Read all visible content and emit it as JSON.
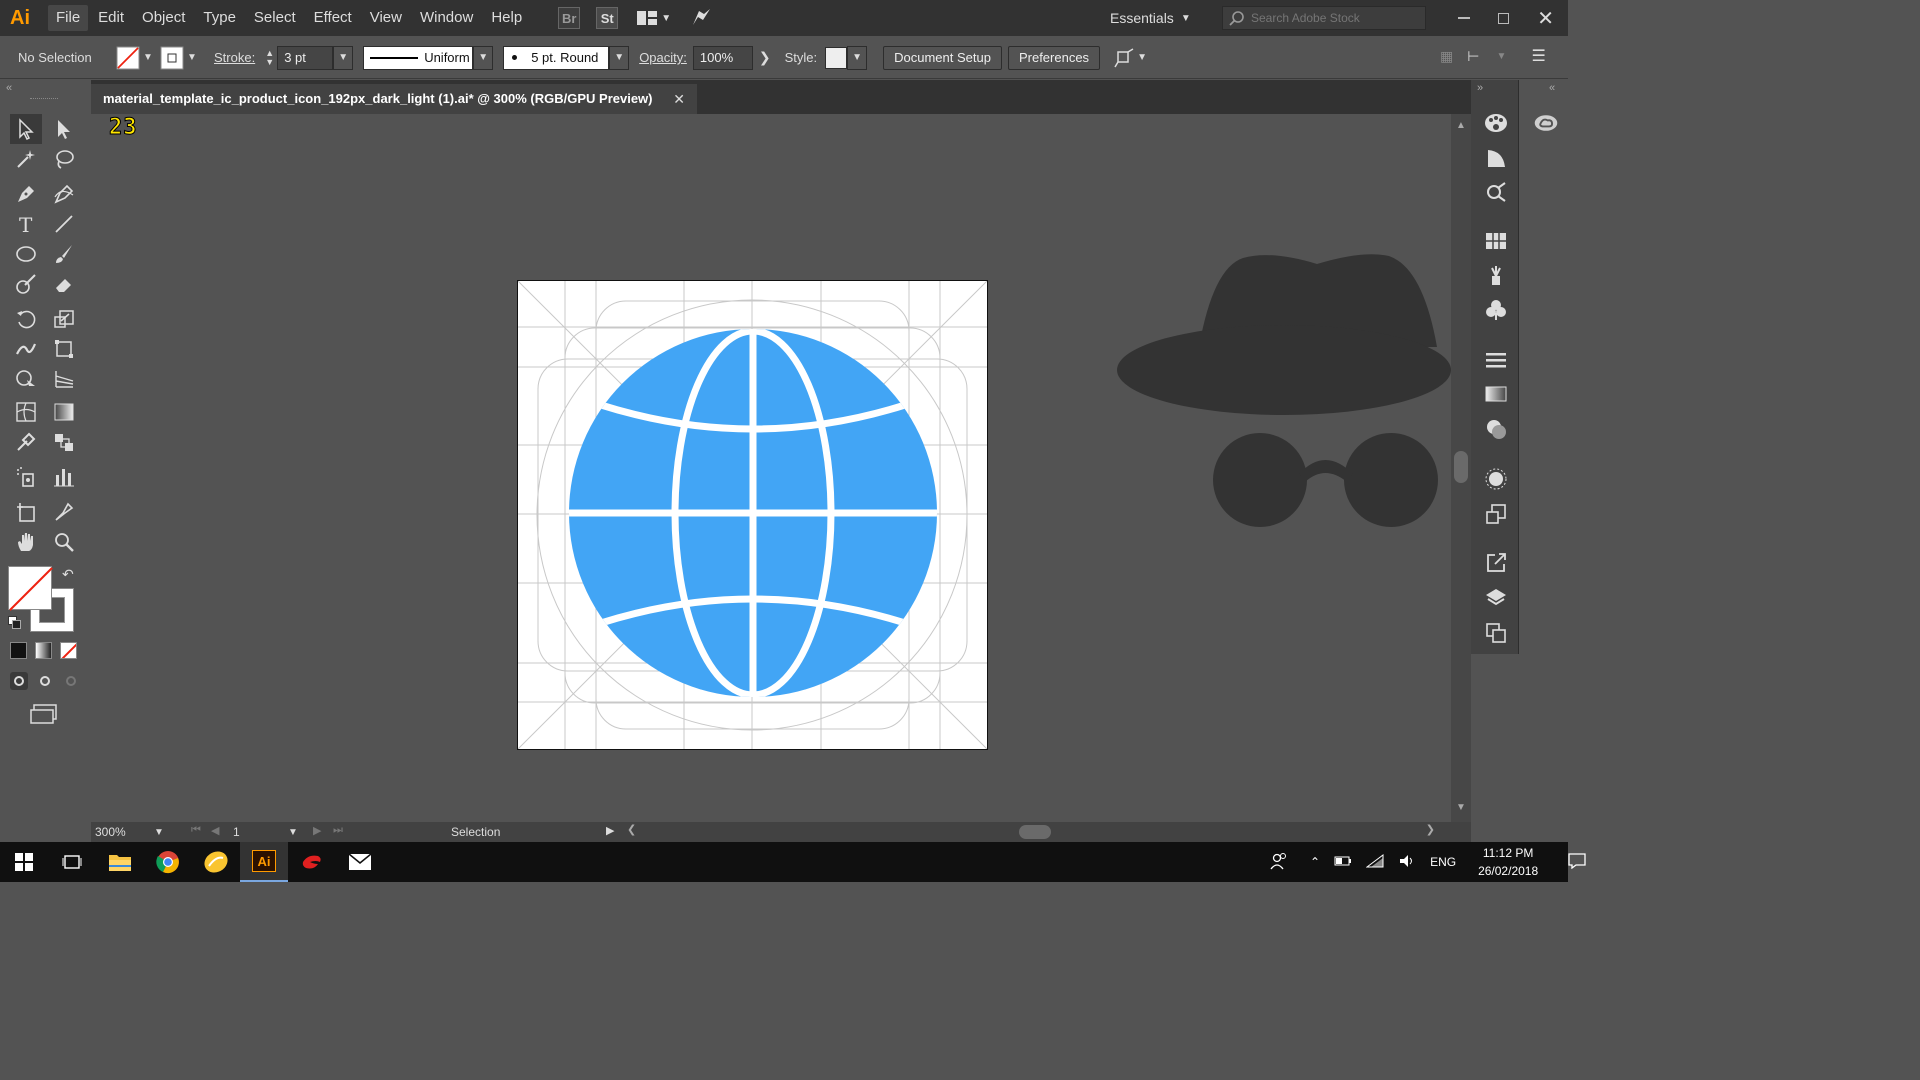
{
  "app": {
    "logo": "Ai",
    "accent": "#FF9A00"
  },
  "menu": {
    "items": [
      {
        "label": "File",
        "active": true
      },
      {
        "label": "Edit"
      },
      {
        "label": "Object"
      },
      {
        "label": "Type"
      },
      {
        "label": "Select"
      },
      {
        "label": "Effect"
      },
      {
        "label": "View"
      },
      {
        "label": "Window"
      },
      {
        "label": "Help"
      }
    ],
    "bridge_label": "Br",
    "stock_label": "St",
    "workspace": "Essentials",
    "search_placeholder": "Search Adobe Stock"
  },
  "control": {
    "selection": "No Selection",
    "stroke_label": "Stroke:",
    "stroke_value": "3 pt",
    "profile": "Uniform",
    "brush": "5 pt. Round",
    "opacity_label": "Opacity:",
    "opacity_value": "100%",
    "style_label": "Style:",
    "doc_setup": "Document Setup",
    "preferences": "Preferences"
  },
  "document": {
    "tab_title": "material_template_ic_product_icon_192px_dark_light (1).ai* @ 300% (RGB/GPU Preview)",
    "badge": "23",
    "globe_color": "#42A5F5",
    "incognito_color": "#333333"
  },
  "status": {
    "zoom": "300%",
    "artboard": "1",
    "tool": "Selection"
  },
  "taskbar": {
    "lang": "ENG",
    "time": "11:12 PM",
    "date": "26/02/2018"
  }
}
